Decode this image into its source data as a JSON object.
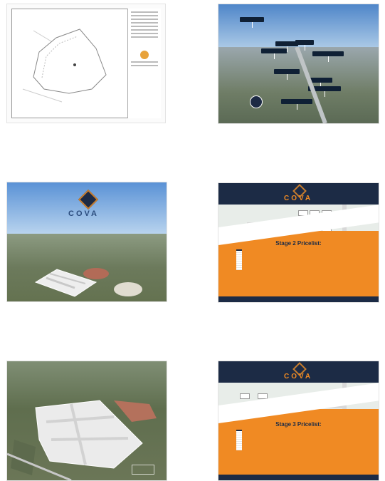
{
  "thumbnails": [
    {
      "id": "survey-plan"
    },
    {
      "id": "aerial-locality",
      "callouts": [
        "",
        "",
        "",
        "",
        "",
        "",
        "",
        "",
        ""
      ]
    },
    {
      "id": "cova-aerial",
      "brand": "COVA"
    },
    {
      "id": "stage2",
      "brand": "COVA",
      "heading": "Stage 2 Pricelist:"
    },
    {
      "id": "site-render"
    },
    {
      "id": "stage3",
      "brand": "COVA",
      "heading": "Stage 3 Pricelist:"
    }
  ],
  "colors": {
    "navy": "#1c2b45",
    "orange": "#f08a23",
    "sky": "#7aa9dc"
  }
}
